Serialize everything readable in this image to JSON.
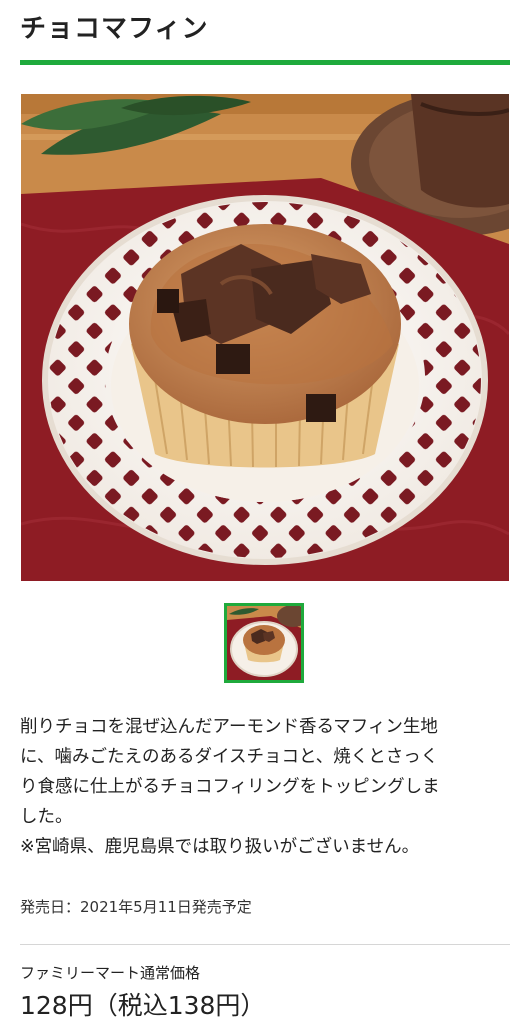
{
  "product": {
    "title": "チョコマフィン",
    "description_lines": [
      "削りチョコを混ぜ込んだアーモンド香るマフィン生地",
      "に、噛みごたえのあるダイスチョコと、焼くとさっく",
      "り食感に仕上がるチョコフィリングをトッピングしま",
      "した。",
      "※宮崎県、鹿児島県では取り扱いがございません。"
    ],
    "release": "発売日：2021年5月11日発売予定",
    "price_label": "ファミリーマート通常価格",
    "price": "128円（税込138円）"
  },
  "colors": {
    "accent": "#1faa3c",
    "tablecloth": "#8e1c24",
    "wood": "#c98a4a",
    "plate": "#fbf7f2",
    "muffin": "#c98a55",
    "chocolate": "#4a2a1e"
  }
}
